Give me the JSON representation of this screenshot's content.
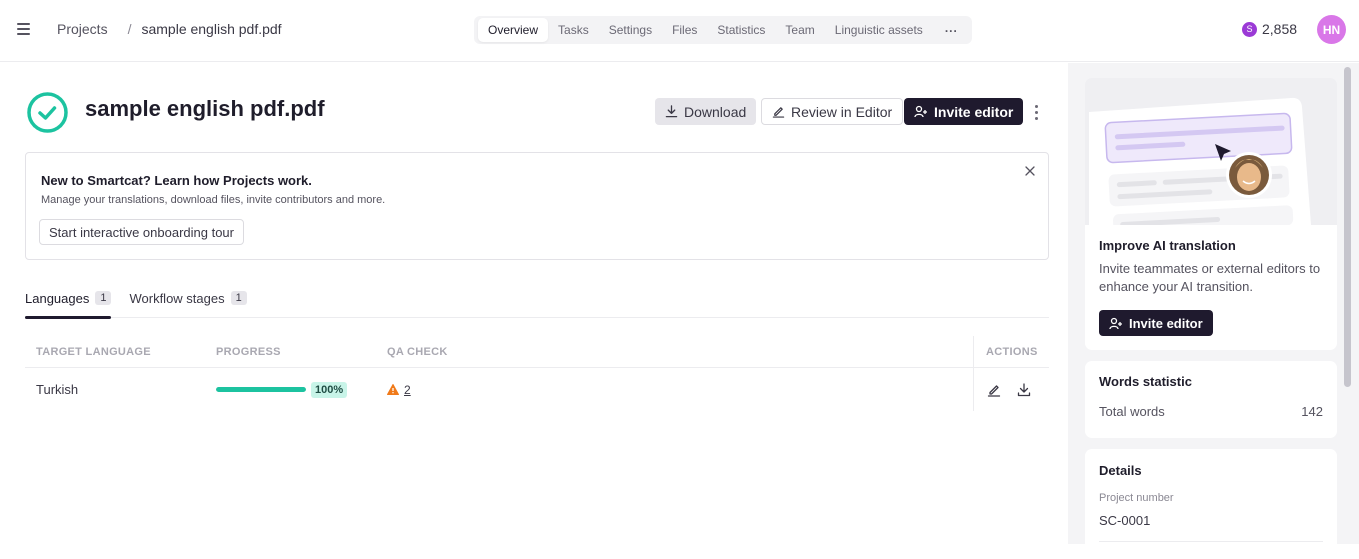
{
  "header": {
    "menu_icon": "hamburger-menu-icon",
    "breadcrumb": {
      "root": "Projects",
      "separator": "/",
      "current": "sample english pdf.pdf"
    },
    "tabs": [
      {
        "label": "Overview",
        "active": true
      },
      {
        "label": "Tasks",
        "active": false
      },
      {
        "label": "Settings",
        "active": false
      },
      {
        "label": "Files",
        "active": false
      },
      {
        "label": "Statistics",
        "active": false
      },
      {
        "label": "Team",
        "active": false
      },
      {
        "label": "Linguistic assets",
        "active": false
      }
    ],
    "more_label": "...",
    "balance": {
      "coin_symbol": "S",
      "amount": "2,858"
    },
    "avatar_initials": "HN",
    "avatar_color": "#d977e8"
  },
  "project": {
    "title": "sample english pdf.pdf",
    "status_icon": "check-circle-icon",
    "status_color": "#1cc3a0",
    "actions": {
      "download": "Download",
      "review": "Review in Editor",
      "invite": "Invite editor"
    }
  },
  "onboarding": {
    "title": "New to Smartcat? Learn how Projects work.",
    "description": "Manage your translations, download files, invite contributors and more.",
    "button": "Start interactive onboarding tour"
  },
  "subtabs": [
    {
      "label": "Languages",
      "count": "1",
      "active": true
    },
    {
      "label": "Workflow stages",
      "count": "1",
      "active": false
    }
  ],
  "table": {
    "columns": [
      "TARGET LANGUAGE",
      "PROGRESS",
      "QA CHECK",
      "ACTIONS"
    ],
    "rows": [
      {
        "language": "Turkish",
        "progress": 100,
        "progress_label": "100%",
        "qa_count": "2",
        "qa_icon": "warning-icon"
      }
    ]
  },
  "sidebar": {
    "promo": {
      "title": "Improve AI translation",
      "description": "Invite teammates or external editors to enhance your AI transition.",
      "button": "Invite editor"
    },
    "words": {
      "title": "Words statistic",
      "label": "Total words",
      "value": "142"
    },
    "details": {
      "title": "Details",
      "label": "Project number",
      "value": "SC-0001"
    }
  },
  "colors": {
    "accent_dark": "#1f1a2e",
    "progress": "#1cc3a0",
    "warning": "#f07a1a",
    "coin": "#9b3ad6"
  }
}
